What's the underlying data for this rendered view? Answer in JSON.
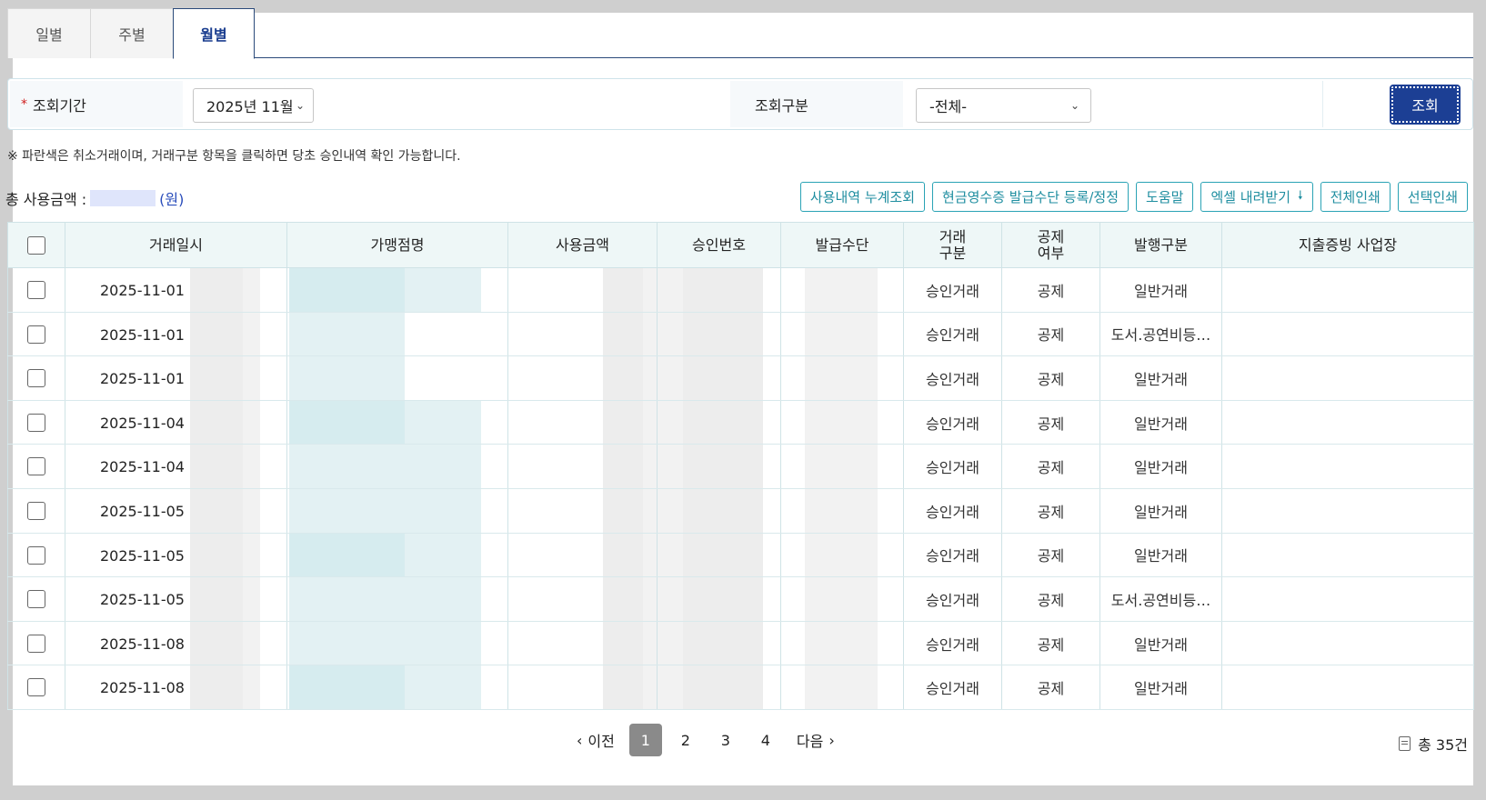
{
  "tabs": [
    {
      "label": "일별",
      "active": false
    },
    {
      "label": "주별",
      "active": false
    },
    {
      "label": "월별",
      "active": true
    }
  ],
  "search": {
    "period_label": "조회기간",
    "period_value": "2025년 11월",
    "type_label": "조회구분",
    "type_value": "-전체-",
    "search_button": "조회"
  },
  "notice": "※ 파란색은 취소거래이며, 거래구분 항목을 클릭하면 당초 승인내역 확인 가능합니다.",
  "total": {
    "label": "총 사용금액 :",
    "unit": "(원)"
  },
  "actions": {
    "cumulative": "사용내역 누계조회",
    "cash_receipt": "현금영수증 발급수단 등록/정정",
    "help": "도움말",
    "excel": "엑셀 내려받기",
    "print_all": "전체인쇄",
    "print_selected": "선택인쇄"
  },
  "columns": {
    "datetime": "거래일시",
    "merchant": "가맹점명",
    "amount": "사용금액",
    "approval": "승인번호",
    "method": "발급수단",
    "txn_type_1": "거래",
    "txn_type_2": "구분",
    "deduct_1": "공제",
    "deduct_2": "여부",
    "issue_type": "발행구분",
    "business": "지출증빙 사업장"
  },
  "rows": [
    {
      "date": "2025-11-01",
      "txn": "승인거래",
      "deduct": "공제",
      "issue": "일반거래"
    },
    {
      "date": "2025-11-01",
      "txn": "승인거래",
      "deduct": "공제",
      "issue": "도서.공연비등…"
    },
    {
      "date": "2025-11-01",
      "txn": "승인거래",
      "deduct": "공제",
      "issue": "일반거래"
    },
    {
      "date": "2025-11-04",
      "txn": "승인거래",
      "deduct": "공제",
      "issue": "일반거래"
    },
    {
      "date": "2025-11-04",
      "txn": "승인거래",
      "deduct": "공제",
      "issue": "일반거래"
    },
    {
      "date": "2025-11-05",
      "txn": "승인거래",
      "deduct": "공제",
      "issue": "일반거래"
    },
    {
      "date": "2025-11-05",
      "txn": "승인거래",
      "deduct": "공제",
      "issue": "일반거래"
    },
    {
      "date": "2025-11-05",
      "txn": "승인거래",
      "deduct": "공제",
      "issue": "도서.공연비등…"
    },
    {
      "date": "2025-11-08",
      "txn": "승인거래",
      "deduct": "공제",
      "issue": "일반거래"
    },
    {
      "date": "2025-11-08",
      "txn": "승인거래",
      "deduct": "공제",
      "issue": "일반거래"
    }
  ],
  "pagination": {
    "prev": "이전",
    "next": "다음",
    "pages": [
      "1",
      "2",
      "3",
      "4"
    ],
    "current": "1"
  },
  "count_label": "총 35건"
}
